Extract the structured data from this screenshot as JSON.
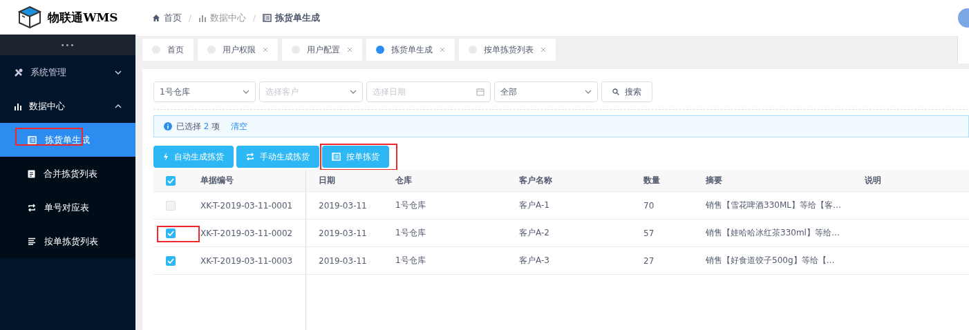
{
  "logo": {
    "title": "物联通WMS"
  },
  "sidebar": {
    "more": "•••",
    "items": [
      {
        "label": "系统管理",
        "expanded": false
      },
      {
        "label": "数据中心",
        "expanded": true,
        "children": [
          {
            "label": "拣货单生成",
            "selected": true,
            "annotated": true
          },
          {
            "label": "合并拣货列表",
            "selected": false,
            "annotated": false
          },
          {
            "label": "单号对应表",
            "selected": false,
            "annotated": false
          },
          {
            "label": "按单拣货列表",
            "selected": false,
            "annotated": false
          }
        ]
      }
    ]
  },
  "breadcrumb": [
    {
      "label": "首页"
    },
    {
      "separator": "/",
      "label": "数据中心"
    },
    {
      "separator": "/",
      "label": "拣货单生成"
    }
  ],
  "tabs": [
    {
      "label": "首页",
      "selected": false,
      "closable": false
    },
    {
      "label": "用户权限",
      "selected": false,
      "closable": true
    },
    {
      "label": "用户配置",
      "selected": false,
      "closable": true
    },
    {
      "label": "拣货单生成",
      "selected": true,
      "closable": true
    },
    {
      "label": "按单拣货列表",
      "selected": false,
      "closable": true
    }
  ],
  "filters": [
    {
      "kind": "select",
      "value": "1号仓库"
    },
    {
      "kind": "select",
      "placeholder": "选择客户"
    },
    {
      "kind": "date",
      "placeholder": "选择日期"
    },
    {
      "kind": "select",
      "value": "全部"
    }
  ],
  "search_button": "搜索",
  "alert": {
    "prefix": "已选择",
    "count": "2",
    "suffix": "项",
    "clear": "清空"
  },
  "actions": [
    {
      "label": "自动生成拣货",
      "annotated": false
    },
    {
      "label": "手动生成拣货",
      "annotated": false
    },
    {
      "label": "按单拣货",
      "annotated": true
    }
  ],
  "table": {
    "all_checked": true,
    "columns": [
      "单据编号",
      "日期",
      "仓库",
      "客户名称",
      "数量",
      "摘要",
      "说明"
    ],
    "rows": [
      {
        "checked": false,
        "disabled": true,
        "annotated": false,
        "cells": [
          "XK-T-2019-03-11-0001",
          "2019-03-11",
          "1号仓库",
          "客户A-1",
          "70",
          "销售【雪花啤酒330ML】等给【客…"
        ]
      },
      {
        "checked": true,
        "disabled": false,
        "annotated": true,
        "cells": [
          "XK-T-2019-03-11-0002",
          "2019-03-11",
          "1号仓库",
          "客户A-2",
          "57",
          "销售【娃哈哈冰红茶330ml】等给…"
        ]
      },
      {
        "checked": true,
        "disabled": false,
        "annotated": false,
        "cells": [
          "XK-T-2019-03-11-0003",
          "2019-03-11",
          "1号仓库",
          "客户A-3",
          "27",
          "销售【好食道饺子500g】等给【…"
        ]
      }
    ]
  }
}
